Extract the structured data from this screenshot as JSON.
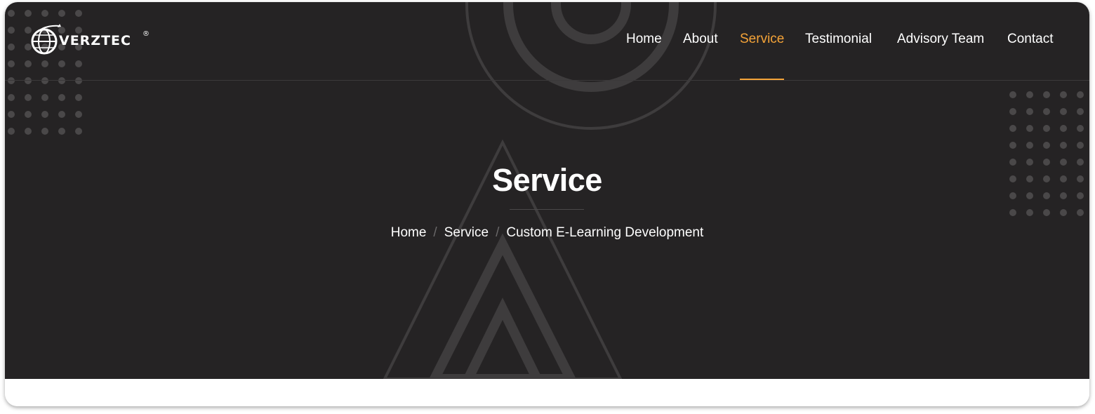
{
  "brand": {
    "name": "VERZTEC",
    "registered_mark": "®"
  },
  "nav": {
    "items": [
      {
        "label": "Home"
      },
      {
        "label": "About"
      },
      {
        "label": "Service"
      },
      {
        "label": "Testimonial"
      },
      {
        "label": "Advisory Team"
      },
      {
        "label": "Contact"
      }
    ],
    "active_index": 2
  },
  "hero": {
    "title": "Service",
    "breadcrumb": {
      "items": [
        "Home",
        "Service",
        "Custom E-Learning Development"
      ],
      "separator": "/"
    }
  },
  "colors": {
    "background": "#252324",
    "accent": "#f4a338",
    "text": "#ffffff",
    "decor": "#474546"
  },
  "icons": {
    "logo": "globe-swoosh-logo-icon"
  }
}
